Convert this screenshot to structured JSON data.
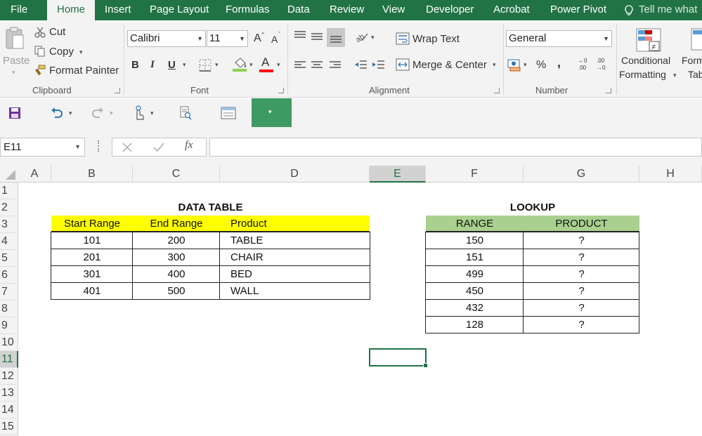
{
  "menu": {
    "tabs": [
      "File",
      "Home",
      "Insert",
      "Page Layout",
      "Formulas",
      "Data",
      "Review",
      "View",
      "Developer",
      "Acrobat",
      "Power Pivot"
    ],
    "active_tab": "Home",
    "tell_me": "Tell me what"
  },
  "ribbon": {
    "clipboard": {
      "paste": "Paste",
      "cut": "Cut",
      "copy": "Copy",
      "format_painter": "Format Painter",
      "label": "Clipboard"
    },
    "font": {
      "name": "Calibri",
      "size": "11",
      "bold": "B",
      "italic": "I",
      "underline": "U",
      "grow": "A",
      "shrink": "A",
      "font_color_letter": "A",
      "label": "Font"
    },
    "alignment": {
      "wrap_text": "Wrap Text",
      "merge_center": "Merge & Center",
      "label": "Alignment"
    },
    "number": {
      "format": "General",
      "percent": "%",
      "comma": ",",
      "inc_decimal": "←0 .00",
      "dec_decimal": ".00 →0",
      "label": "Number"
    },
    "styles": {
      "conditional_line1": "Conditional",
      "conditional_line2": "Formatting",
      "format_table_line1": "Form",
      "format_table_line2": "Tab"
    }
  },
  "formula_bar": {
    "name_box": "E11",
    "fx": "fx",
    "value": ""
  },
  "grid": {
    "columns": [
      "A",
      "B",
      "C",
      "D",
      "E",
      "F",
      "G",
      "H"
    ],
    "selected_column": "E",
    "rows": [
      "1",
      "2",
      "3",
      "4",
      "5",
      "6",
      "7",
      "8",
      "9",
      "10",
      "11",
      "12",
      "13",
      "14",
      "15"
    ],
    "selected_row": "11",
    "active_cell": "E11"
  },
  "data_table": {
    "title": "DATA TABLE",
    "headers": [
      "Start Range",
      "End Range",
      "Product"
    ],
    "rows": [
      [
        "101",
        "200",
        "TABLE"
      ],
      [
        "201",
        "300",
        "CHAIR"
      ],
      [
        "301",
        "400",
        "BED"
      ],
      [
        "401",
        "500",
        "WALL"
      ]
    ],
    "header_color": "#ffff00"
  },
  "lookup_table": {
    "title": "LOOKUP",
    "headers": [
      "RANGE",
      "PRODUCT"
    ],
    "rows": [
      [
        "150",
        "?"
      ],
      [
        "151",
        "?"
      ],
      [
        "499",
        "?"
      ],
      [
        "450",
        "?"
      ],
      [
        "432",
        "?"
      ],
      [
        "128",
        "?"
      ]
    ],
    "header_color": "#a9d08e"
  },
  "colors": {
    "accent": "#217346",
    "qat_highlight": "#3e9a63"
  }
}
